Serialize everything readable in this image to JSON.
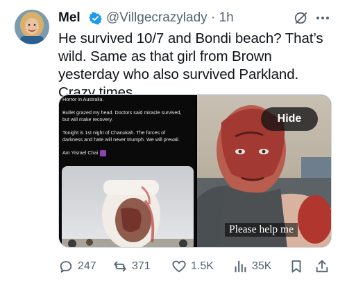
{
  "tweet": {
    "display_name": "Mel",
    "handle": "@Villgecrazylady",
    "separator": "·",
    "time": "1h",
    "text": "He survived 10/7 and Bondi beach? That’s wild. Same as that girl from Brown yesterday who also survived Parkland. Crazy times."
  },
  "media": {
    "left_screenshot": {
      "line1": "Horror in Australia.",
      "line2": "Bullet grazed my head. Doctors said miracle survived,",
      "line3": "but will make recovery.",
      "line4": "Tonight is 1st night of Chanukah. The forces of",
      "line5": "darkness and hate will never triumph. We will prevail.",
      "line6": "Am Yisrael Chai"
    },
    "right_image": {
      "hide_label": "Hide",
      "caption": "Please help me"
    }
  },
  "actions": {
    "replies": "247",
    "reposts": "371",
    "likes": "1.5K",
    "views": "35K"
  },
  "icons": {
    "verified": "verified-badge-icon",
    "grok": "grok-icon",
    "more": "more-dots-icon",
    "reply": "reply-icon",
    "repost": "repost-icon",
    "like": "heart-icon",
    "views": "views-chart-icon",
    "bookmark": "bookmark-icon",
    "share": "share-icon"
  },
  "colors": {
    "text": "#0f1419",
    "secondary": "#536471",
    "verified": "#1d9bf0"
  }
}
